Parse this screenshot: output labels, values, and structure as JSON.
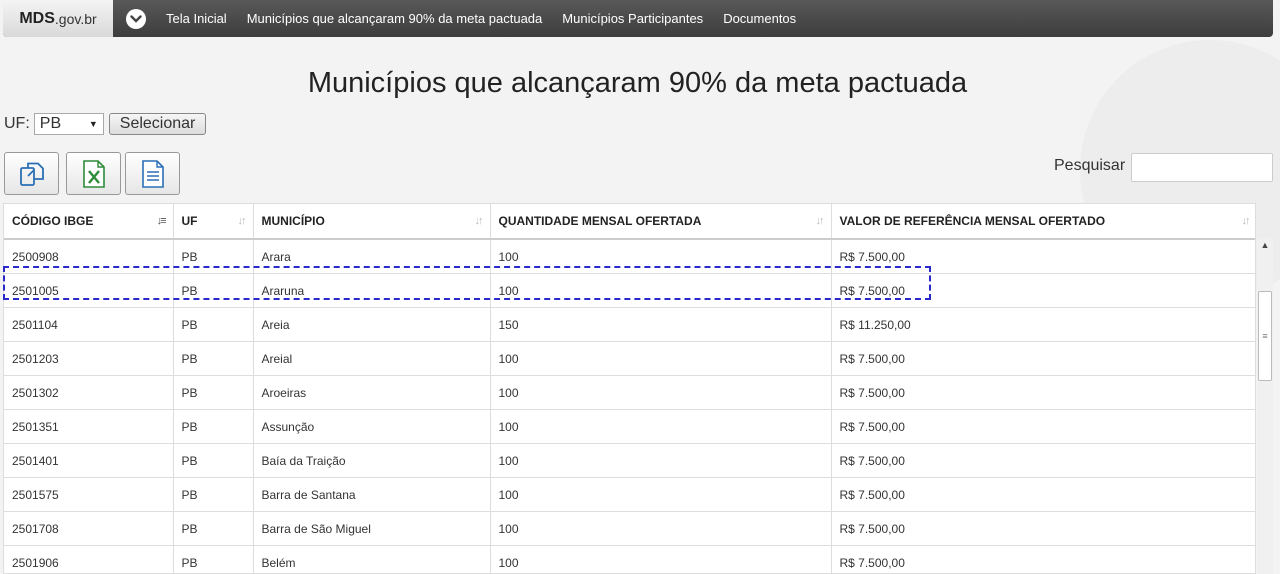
{
  "nav": {
    "brand_bold": "MDS",
    "brand_light": ".gov.br",
    "links": [
      "Tela Inicial",
      "Municípios que alcançaram 90% da meta pactuada",
      "Municípios Participantes",
      "Documentos"
    ]
  },
  "page": {
    "title": "Municípios que alcançaram 90% da meta pactuada"
  },
  "filter": {
    "uf_label": "UF:",
    "uf_value": "PB",
    "select_button": "Selecionar"
  },
  "search": {
    "label": "Pesquisar",
    "value": ""
  },
  "table": {
    "headers": [
      "CÓDIGO IBGE",
      "UF",
      "MUNICÍPIO",
      "QUANTIDADE MENSAL OFERTADA",
      "VALOR DE REFERÊNCIA MENSAL OFERTADO"
    ],
    "sorted_column": "CÓDIGO IBGE",
    "rows": [
      [
        "2500908",
        "PB",
        "Arara",
        "100",
        "R$ 7.500,00"
      ],
      [
        "2501005",
        "PB",
        "Araruna",
        "100",
        "R$ 7.500,00"
      ],
      [
        "2501104",
        "PB",
        "Areia",
        "150",
        "R$ 11.250,00"
      ],
      [
        "2501203",
        "PB",
        "Areial",
        "100",
        "R$ 7.500,00"
      ],
      [
        "2501302",
        "PB",
        "Aroeiras",
        "100",
        "R$ 7.500,00"
      ],
      [
        "2501351",
        "PB",
        "Assunção",
        "100",
        "R$ 7.500,00"
      ],
      [
        "2501401",
        "PB",
        "Baía da Traição",
        "100",
        "R$ 7.500,00"
      ],
      [
        "2501575",
        "PB",
        "Barra de Santana",
        "100",
        "R$ 7.500,00"
      ],
      [
        "2501708",
        "PB",
        "Barra de São Miguel",
        "100",
        "R$ 7.500,00"
      ],
      [
        "2501906",
        "PB",
        "Belém",
        "100",
        "R$ 7.500,00"
      ]
    ]
  },
  "colors": {
    "navbar": "#4a4a4a",
    "highlight": "#2a2acc",
    "excel_green": "#2e8b3a",
    "icon_blue": "#2a6fb5"
  }
}
